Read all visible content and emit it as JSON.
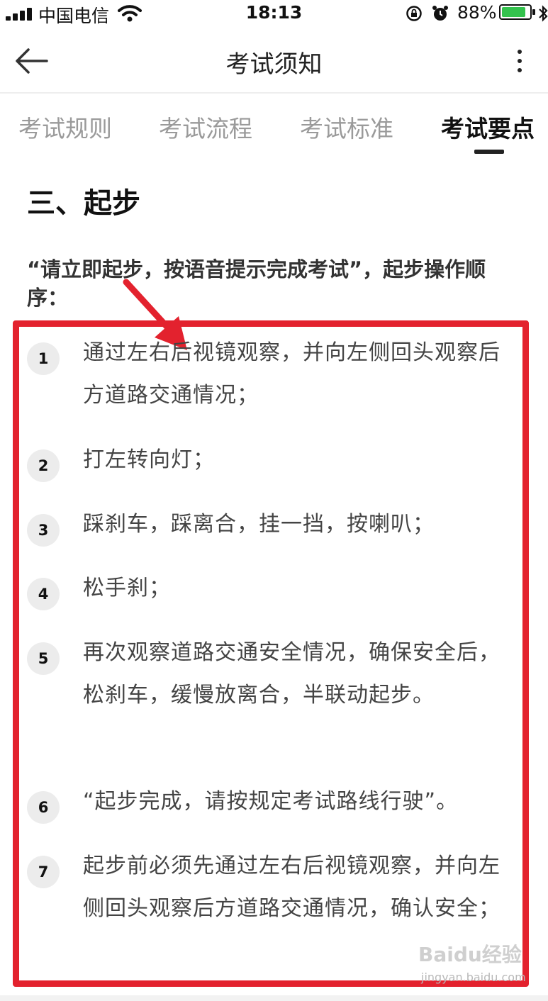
{
  "status_bar": {
    "carrier": "中国电信",
    "time": "18:13",
    "battery_percent": "88%",
    "battery_level": 0.88,
    "battery_color": "#33c24d",
    "icons": [
      "signal-icon",
      "wifi-icon",
      "rotation-lock-icon",
      "alarm-icon",
      "battery-icon",
      "bluetooth-icon"
    ]
  },
  "nav": {
    "title": "考试须知",
    "back_icon": "back-arrow-icon",
    "more_icon": "more-vertical-icon"
  },
  "tabs": [
    {
      "label": "考试规则",
      "active": false
    },
    {
      "label": "考试流程",
      "active": false
    },
    {
      "label": "考试标准",
      "active": false
    },
    {
      "label": "考试要点",
      "active": true
    }
  ],
  "content": {
    "section_title": "三、起步",
    "intro": "“请立即起步，按语音提示完成考试”，起步操作顺序：",
    "steps": [
      {
        "num": "1",
        "text": "通过左右后视镜观察，并向左侧回头观察后方道路交通情况；"
      },
      {
        "num": "2",
        "text": "打左转向灯；"
      },
      {
        "num": "3",
        "text": "踩刹车，踩离合，挂一挡，按喇叭；"
      },
      {
        "num": "4",
        "text": "松手刹；"
      },
      {
        "num": "5",
        "text": "再次观察道路交通安全情况，确保安全后，松刹车，缓慢放离合，半联动起步。"
      },
      {
        "num": "6",
        "text": "“起步完成，请按规定考试路线行驶”。"
      },
      {
        "num": "7",
        "text": "起步前必须先通过左右后视镜观察，并向左侧回头观察后方道路交通情况，确认安全；"
      }
    ]
  },
  "annotation": {
    "color": "#e3222e",
    "arrow_icon": "red-arrow-icon"
  },
  "watermark": {
    "logo": "Baidu经验",
    "url": "jingyan.baidu.com"
  }
}
